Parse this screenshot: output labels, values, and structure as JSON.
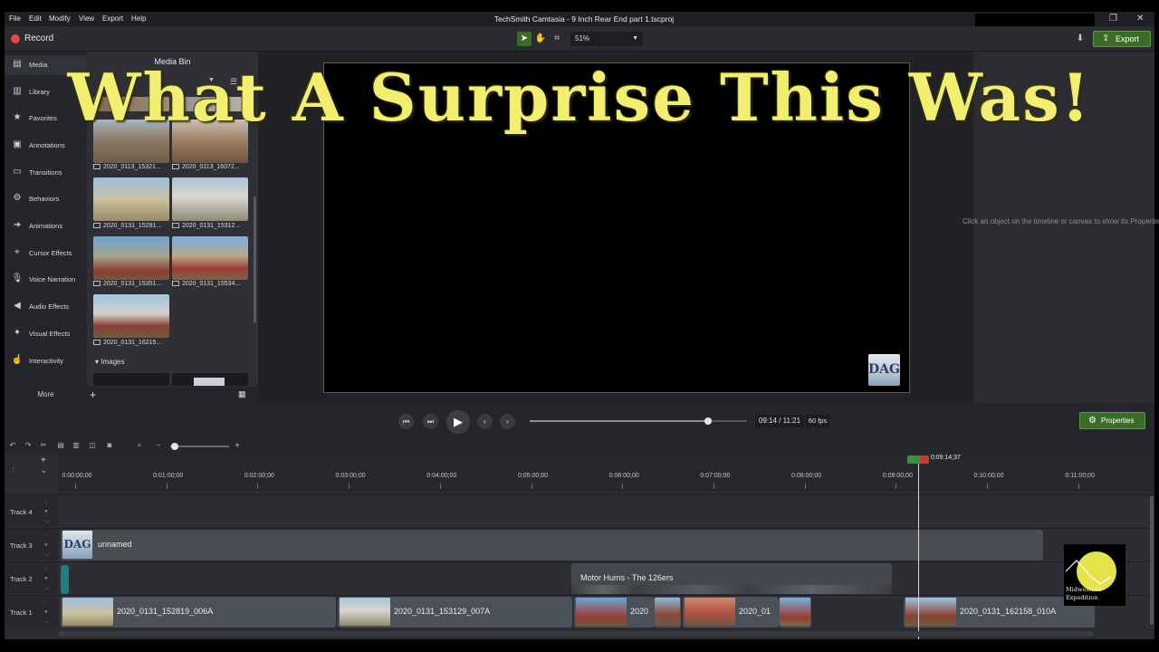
{
  "window": {
    "title": "TechSmith Camtasia - 9 Inch Rear End part 1.tscproj",
    "menus": [
      "File",
      "Edit",
      "Modify",
      "View",
      "Export",
      "Help"
    ]
  },
  "toolbar": {
    "record_label": "Record",
    "zoom_value": "51%",
    "export_label": "Export"
  },
  "overlay_title": "What A Surprise This Was!",
  "sidebar": {
    "items": [
      {
        "label": "Media",
        "icon": "film-icon"
      },
      {
        "label": "Library",
        "icon": "library-icon"
      },
      {
        "label": "Favorites",
        "icon": "star-icon"
      },
      {
        "label": "Annotations",
        "icon": "annotation-icon"
      },
      {
        "label": "Transitions",
        "icon": "transition-icon"
      },
      {
        "label": "Behaviors",
        "icon": "behavior-icon"
      },
      {
        "label": "Animations",
        "icon": "animation-icon"
      },
      {
        "label": "Cursor Effects",
        "icon": "cursor-icon"
      },
      {
        "label": "Voice Narration",
        "icon": "microphone-icon"
      },
      {
        "label": "Audio Effects",
        "icon": "speaker-icon"
      },
      {
        "label": "Visual Effects",
        "icon": "wand-icon"
      },
      {
        "label": "Interactivity",
        "icon": "pointer-icon"
      }
    ],
    "more_label": "More"
  },
  "media_bin": {
    "title": "Media Bin",
    "thumbnails": [
      {
        "label": "2020_0113_15321..."
      },
      {
        "label": "2020_0113_16072..."
      },
      {
        "label": "2020_0131_15281..."
      },
      {
        "label": "2020_0131_15312..."
      },
      {
        "label": "2020_0131_15351..."
      },
      {
        "label": "2020_0131_15534..."
      },
      {
        "label": "2020_0131_16215..."
      }
    ],
    "images_label": "Images"
  },
  "canvas": {
    "watermark_text": "DAG"
  },
  "properties": {
    "hint": "Click an object on the timeline or canvas to show its Properties.",
    "button_label": "Properties"
  },
  "playback": {
    "progress": 0.821,
    "time": "09:14 / 11:21",
    "fps": "60 fps"
  },
  "timeline": {
    "playhead_time": "0:09:14;37",
    "ruler_labels": [
      "0:00:00;00",
      "0:01:00;00",
      "0:02:00;00",
      "0:03:00;00",
      "0:04:00;00",
      "0:05:00;00",
      "0:06:00;00",
      "0:07:00;00",
      "0:08:00;00",
      "0:09:00;00",
      "0:10:00;00",
      "0:11:00;00"
    ],
    "tracks": [
      {
        "name": "Track 4"
      },
      {
        "name": "Track 3"
      },
      {
        "name": "Track 2"
      },
      {
        "name": "Track 1"
      }
    ],
    "clips": {
      "track3_label": "unnamed",
      "track2_label": "Motor Hums - The 126ers",
      "track1": [
        "2020_0131_152819_006A",
        "2020_0131_153129_007A",
        "2020",
        "2020_01",
        "2020_0131_162158_010A"
      ]
    }
  },
  "logo": {
    "text_line1": "Midwestern",
    "text_line2": "Expedition"
  },
  "colors": {
    "accent_green": "#3b6c27",
    "title_yellow": "#f2ee70",
    "record_red": "#e5483f"
  }
}
